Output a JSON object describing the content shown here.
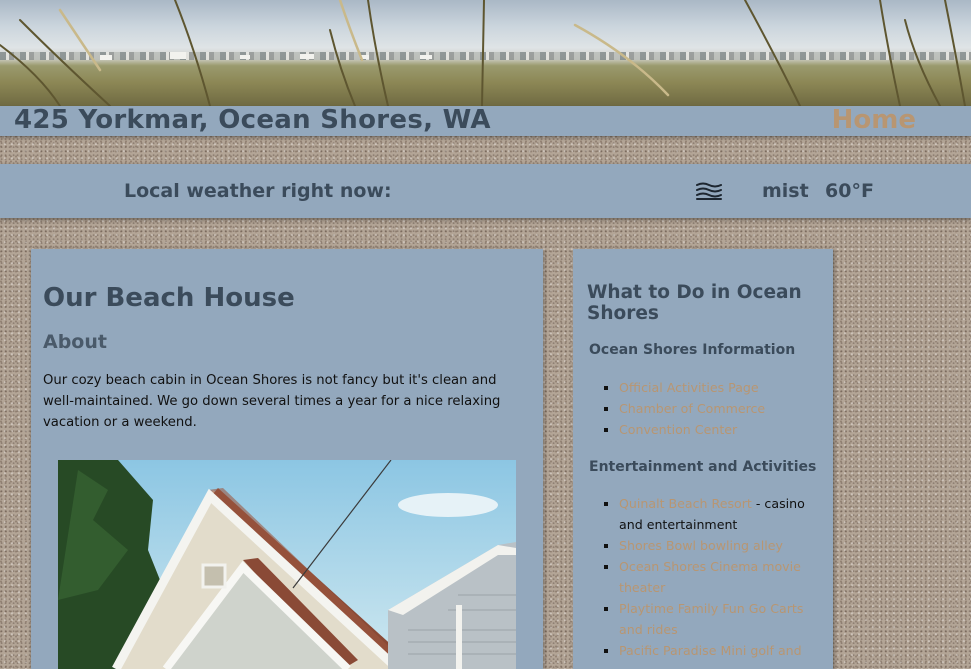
{
  "header": {
    "site_title": "425 Yorkmar, Ocean Shores, WA",
    "home_label": "Home"
  },
  "weather": {
    "label": "Local weather right now:",
    "icon": "mist-icon",
    "description": "mist",
    "temperature": "60°F"
  },
  "main": {
    "title": "Our Beach House",
    "about_heading": "About",
    "about_text": "Our cozy beach cabin in Ocean Shores is not fancy but it's clean and well-maintained. We go down several times a year for a nice relaxing vacation or a weekend."
  },
  "sidebar": {
    "title": "What to Do in Ocean Shores",
    "sections": [
      {
        "heading": "Ocean Shores Information",
        "items": [
          {
            "link": "Official Activities Page",
            "suffix": ""
          },
          {
            "link": "Chamber of Commerce",
            "suffix": ""
          },
          {
            "link": "Convention Center",
            "suffix": ""
          }
        ]
      },
      {
        "heading": "Entertainment and Activities",
        "items": [
          {
            "link": "Quinalt Beach Resort",
            "suffix": " - casino and entertainment"
          },
          {
            "link": "Shores Bowl bowling alley",
            "suffix": ""
          },
          {
            "link": "Ocean Shores Cinema movie theater",
            "suffix": ""
          },
          {
            "link": "Playtime Family Fun Go Carts and rides",
            "suffix": ""
          },
          {
            "link": "Pacific Paradise Mini golf and",
            "suffix": ""
          }
        ]
      }
    ]
  },
  "colors": {
    "panel": "#93a8bd",
    "heading": "#3b4b5b",
    "link": "#b89672"
  }
}
